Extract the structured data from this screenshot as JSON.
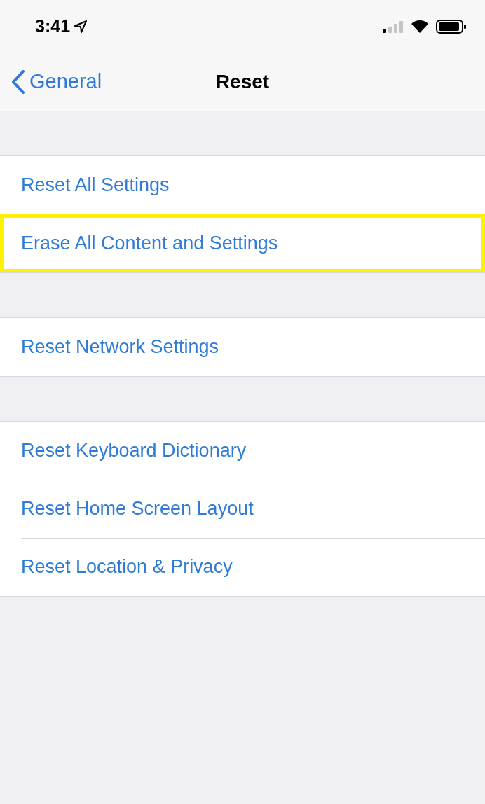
{
  "status_bar": {
    "time": "3:41"
  },
  "nav": {
    "back_label": "General",
    "title": "Reset"
  },
  "groups": [
    {
      "items": [
        {
          "label": "Reset All Settings",
          "highlighted": false
        },
        {
          "label": "Erase All Content and Settings",
          "highlighted": true
        }
      ]
    },
    {
      "items": [
        {
          "label": "Reset Network Settings",
          "highlighted": false
        }
      ]
    },
    {
      "items": [
        {
          "label": "Reset Keyboard Dictionary",
          "highlighted": false
        },
        {
          "label": "Reset Home Screen Layout",
          "highlighted": false
        },
        {
          "label": "Reset Location & Privacy",
          "highlighted": false
        }
      ]
    }
  ]
}
